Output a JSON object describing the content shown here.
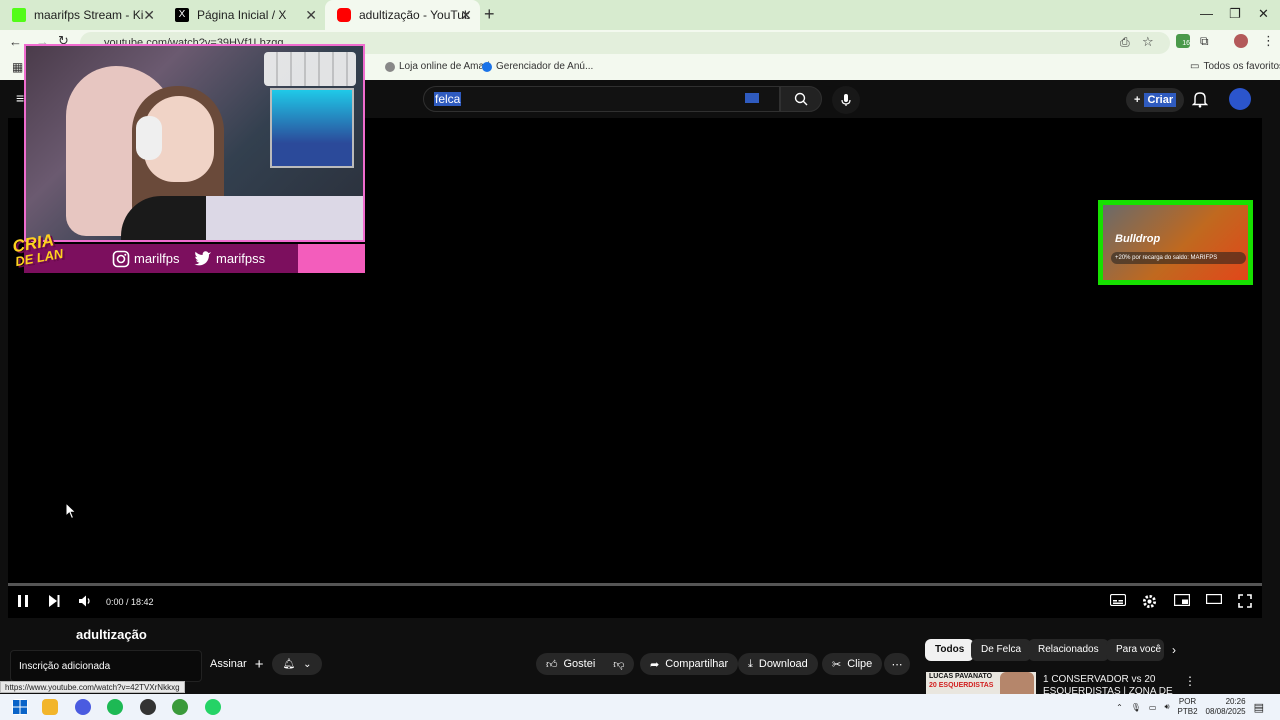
{
  "browser": {
    "tabs": [
      {
        "label": "maarifps Stream - Kick Dashboard",
        "icon": "kick-icon",
        "color": "#53fc18",
        "active": false
      },
      {
        "label": "Página Inicial / X",
        "icon": "x-icon",
        "color": "#000000",
        "active": false
      },
      {
        "label": "adultização - YouTube",
        "icon": "youtube-icon",
        "color": "#ff0000",
        "active": true
      }
    ],
    "address": "youtube.com/watch?v=39HVf1Lbzgg",
    "bookmarks": [
      {
        "label": "Loja online de Amari"
      },
      {
        "label": "Gerenciador de Anú..."
      }
    ],
    "bookmarks_right": "Todos os favoritos",
    "extension_badge": "16"
  },
  "youtube": {
    "search_value": "felca",
    "create_label": "Criar",
    "video": {
      "time": "0:00 / 18:42",
      "title": "adultização",
      "progress": 0.0
    },
    "overlay": {
      "instagram": "marilfps",
      "twitter": "marifpss",
      "logo_text_1": "CRIA",
      "logo_text_2": "DE LAN",
      "sponsor_brand": "Bulldrop",
      "sponsor_promo": "+20% por recarga do saldo: MARIFPS"
    },
    "actions": {
      "subscribe": "Assinar",
      "like": "Gostei",
      "share": "Compartilhar",
      "download": "Download",
      "clip": "Clipe"
    },
    "toast": "Inscrição adicionada",
    "status_url": "https://www.youtube.com/watch?v=42TVXrNkkxg",
    "chips": [
      "Todos",
      "De Felca",
      "Relacionados",
      "Para você"
    ],
    "recommendation": {
      "thumb_line1": "LUCAS PAVANATO",
      "thumb_line2": "20 ESQUERDISTAS",
      "title": "1 CONSERVADOR vs 20 ESQUERDISTAS | ZONA DE"
    }
  },
  "taskbar": {
    "lang": "POR",
    "layout": "PTB2",
    "time": "20:26",
    "date": "08/08/2025"
  },
  "colors": {
    "tab_strip": "#d7ebcf",
    "youtube_bg": "#0f0f0f",
    "selection": "#2f5bbf",
    "overlay_pink": "#f35dbc",
    "overlay_purple": "#7c0f5e",
    "sponsor_green": "#16e000"
  }
}
